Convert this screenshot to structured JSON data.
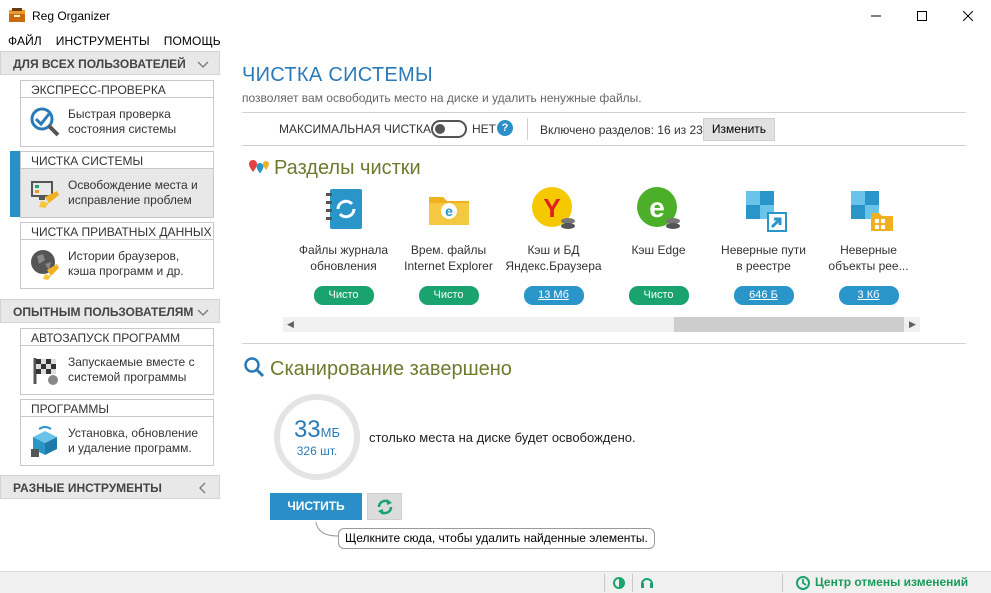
{
  "window": {
    "title": "Reg Organizer"
  },
  "menu": [
    "ФАЙЛ",
    "ИНСТРУМЕНТЫ",
    "ПОМОЩЬ"
  ],
  "sidebar": {
    "section_all": "ДЛЯ ВСЕХ ПОЛЬЗОВАТЕЛЕЙ",
    "section_advanced": "ОПЫТНЫМ ПОЛЬЗОВАТЕЛЯМ",
    "section_misc": "РАЗНЫЕ ИНСТРУМЕНТЫ",
    "cards": [
      {
        "title": "ЭКСПРЕСС-ПРОВЕРКА",
        "line1": "Быстрая проверка",
        "line2": "состояния системы"
      },
      {
        "title": "ЧИСТКА СИСТЕМЫ",
        "line1": "Освобождение места и",
        "line2": "исправление проблем"
      },
      {
        "title": "ЧИСТКА ПРИВАТНЫХ ДАННЫХ",
        "line1": "Истории браузеров,",
        "line2": "кэша программ и др."
      },
      {
        "title": "АВТОЗАПУСК ПРОГРАММ",
        "line1": "Запускаемые вместе с",
        "line2": "системой программы"
      },
      {
        "title": "ПРОГРАММЫ",
        "line1": "Установка, обновление",
        "line2": "и удаление программ."
      }
    ]
  },
  "main": {
    "title": "ЧИСТКА СИСТЕМЫ",
    "subtitle": "позволяет вам освободить место на диске и удалить ненужные файлы.",
    "max_clean_label": "МАКСИМАЛЬНАЯ ЧИСТКА",
    "max_clean_value": "НЕТ",
    "help": "?",
    "sections_enabled": "Включено разделов: 16 из 23",
    "change_button": "Изменить",
    "sections_heading": "Разделы чистки",
    "tiles": [
      {
        "line1": "Файлы журнала",
        "line2": "обновления",
        "status": "Чисто",
        "kind": "green"
      },
      {
        "line1": "Врем. файлы",
        "line2": "Internet Explorer",
        "status": "Чисто",
        "kind": "green"
      },
      {
        "line1": "Кэш и БД",
        "line2": "Яндекс.Браузера",
        "status": "13 Мб",
        "kind": "blue"
      },
      {
        "line1": "Кэш Edge",
        "line2": "",
        "status": "Чисто",
        "kind": "green"
      },
      {
        "line1": "Неверные пути",
        "line2": "в реестре",
        "status": "646 Б",
        "kind": "blue"
      },
      {
        "line1": "Неверные",
        "line2": "объекты рее...",
        "status": "3 Кб",
        "kind": "blue"
      }
    ],
    "scan_heading": "Сканирование завершено",
    "scan_size": "33",
    "scan_unit": "МБ",
    "scan_count": "326 шт.",
    "scan_desc": "столько места на диске будет освобождено.",
    "clean_button": "ЧИСТИТЬ",
    "tooltip": "Щелкните сюда, чтобы удалить найденные элементы."
  },
  "status": {
    "undo_center": "Центр отмены изменений"
  },
  "colors": {
    "accent": "#2a8fc9",
    "clean": "#1aa36e",
    "olive": "#6f7a2e"
  }
}
